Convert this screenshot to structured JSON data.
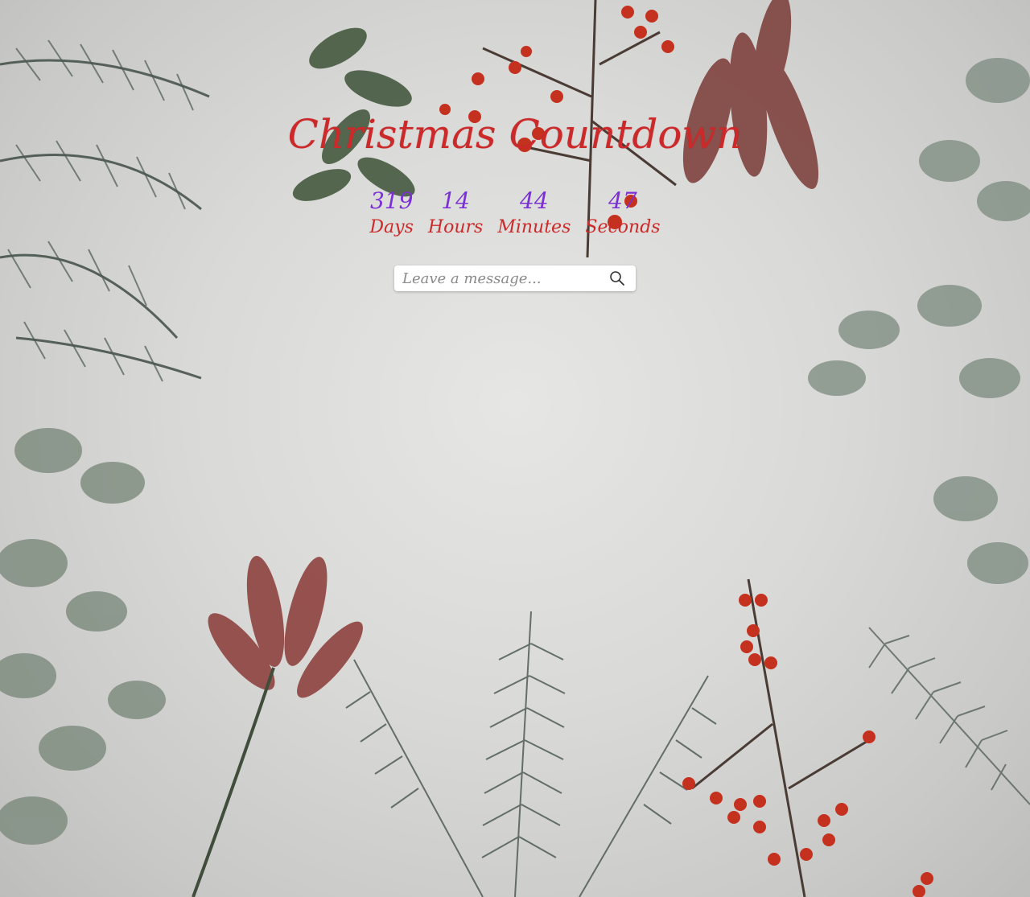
{
  "page": {
    "title": "Christmas Countdown"
  },
  "countdown": [
    {
      "value": "319",
      "label": "Days"
    },
    {
      "value": "14",
      "label": "Hours"
    },
    {
      "value": "44",
      "label": "Minutes"
    },
    {
      "value": "47",
      "label": "Seconds"
    }
  ],
  "search": {
    "placeholder": "Leave a message...",
    "icon": "search-icon"
  },
  "colors": {
    "title": "#cc2a2a",
    "number": "#7b2fd6",
    "label": "#cc2a2a"
  }
}
